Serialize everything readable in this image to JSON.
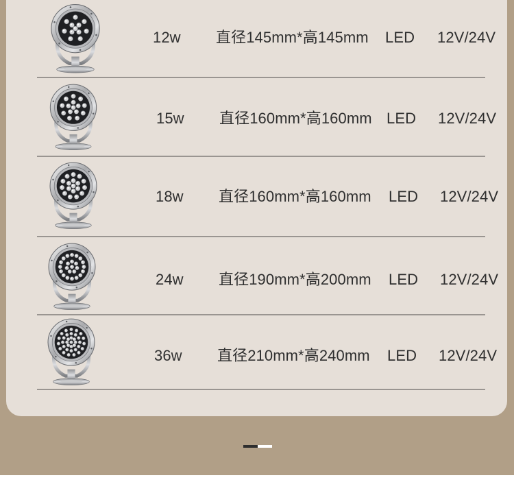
{
  "spec_table": {
    "rows": [
      {
        "power": "12w",
        "size": "直径145mm*高145mm",
        "light_source": "LED",
        "voltage": "12V/24V",
        "led_count": 12
      },
      {
        "power": "15w",
        "size": "直径160mm*高160mm",
        "light_source": "LED",
        "voltage": "12V/24V",
        "led_count": 15
      },
      {
        "power": "18w",
        "size": "直径160mm*高160mm",
        "light_source": "LED",
        "voltage": "12V/24V",
        "led_count": 18
      },
      {
        "power": "24w",
        "size": "直径190mm*高200mm",
        "light_source": "LED",
        "voltage": "12V/24V",
        "led_count": 24
      },
      {
        "power": "36w",
        "size": "直径210mm*高240mm",
        "light_source": "LED",
        "voltage": "12V/24V",
        "led_count": 36
      }
    ]
  },
  "colors": {
    "outer_background": "#b19f87",
    "card_background": "#e6dfd8",
    "divider": "#9a9591",
    "text": "#2f2f2f"
  },
  "icons": {
    "product_image": "underwater-led-spotlight-icon"
  }
}
